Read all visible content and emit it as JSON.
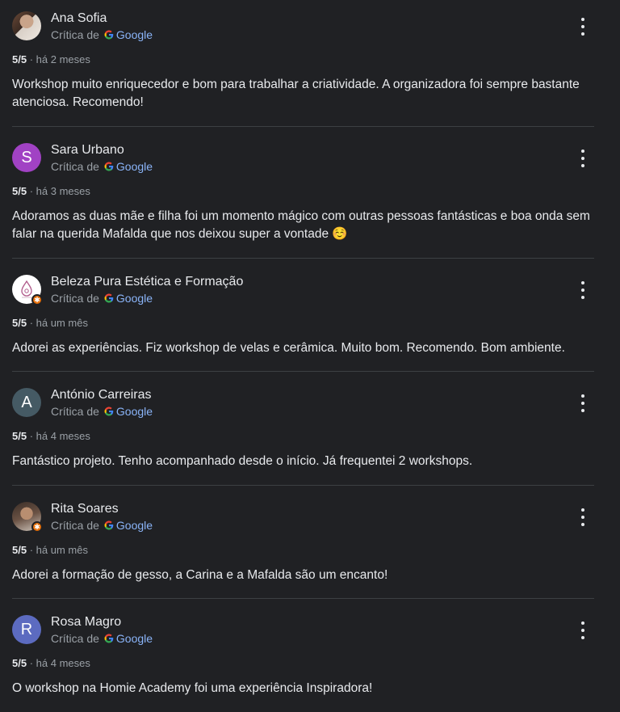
{
  "reviews": [
    {
      "name": "Ana Sofia",
      "source_prefix": "Crítica de",
      "source_brand": "Google",
      "rating": "5/5",
      "time": "há 2 meses",
      "text": "Workshop muito enriquecedor e bom para trabalhar a criatividade. A organizadora foi sempre bastante atenciosa. Recomendo!",
      "avatar": {
        "type": "photo",
        "initial": ""
      }
    },
    {
      "name": "Sara Urbano",
      "source_prefix": "Crítica de",
      "source_brand": "Google",
      "rating": "5/5",
      "time": "há 3 meses",
      "text": "Adoramos as duas mãe e filha foi um momento mágico com outras pessoas fantásticas e boa onda sem falar na querida Mafalda que nos deixou super a vontade ☺️",
      "avatar": {
        "type": "initial",
        "initial": "S",
        "color": "#a142c4"
      }
    },
    {
      "name": "Beleza Pura Estética e Formação",
      "source_prefix": "Crítica de",
      "source_brand": "Google",
      "rating": "5/5",
      "time": "há um mês",
      "text": "Adorei as experiências. Fiz workshop de velas e cerâmica. Muito bom. Recomendo. Bom ambiente.",
      "avatar": {
        "type": "logo",
        "initial": "",
        "local_guide": true
      }
    },
    {
      "name": "António Carreiras",
      "source_prefix": "Crítica de",
      "source_brand": "Google",
      "rating": "5/5",
      "time": "há 4 meses",
      "text": "Fantástico projeto. Tenho acompanhado desde o início. Já frequentei 2 workshops.",
      "avatar": {
        "type": "initial",
        "initial": "A",
        "color": "#455a64"
      }
    },
    {
      "name": "Rita Soares",
      "source_prefix": "Crítica de",
      "source_brand": "Google",
      "rating": "5/5",
      "time": "há um mês",
      "text": "Adorei a formação de gesso, a Carina e a Mafalda são um encanto!",
      "avatar": {
        "type": "photo",
        "initial": "",
        "local_guide": true
      }
    },
    {
      "name": "Rosa Magro",
      "source_prefix": "Crítica de",
      "source_brand": "Google",
      "rating": "5/5",
      "time": "há 4 meses",
      "text": "O workshop na Homie Academy foi uma experiência Inspiradora!",
      "avatar": {
        "type": "initial",
        "initial": "R",
        "color": "#5c6bc0"
      }
    }
  ],
  "colors": {
    "background": "#202124",
    "text_primary": "#e8eaed",
    "text_secondary": "#9aa0a6",
    "link": "#8ab4f8",
    "divider": "#3c4043",
    "local_guide_badge": "#e8710a"
  }
}
